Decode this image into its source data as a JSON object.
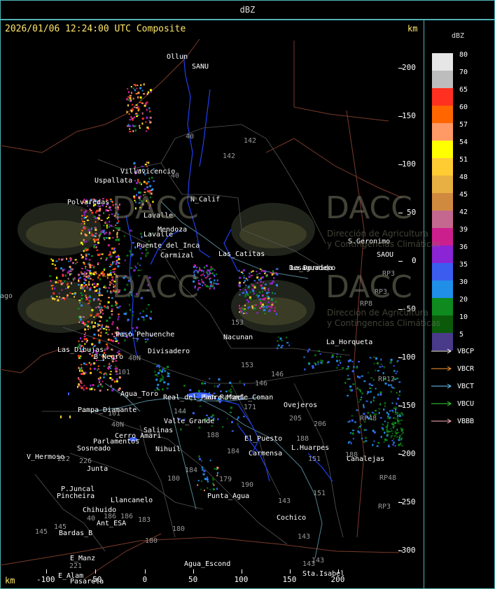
{
  "header": {
    "title": "dBZ"
  },
  "map": {
    "timestamp": "2026/01/06 12:24:00 UTC Composite",
    "km_top": "km",
    "km_bottom": "km",
    "y_ticks": [
      "200",
      "150",
      "100",
      "50",
      "0",
      "-50",
      "-100",
      "-150",
      "-200",
      "-250",
      "-300"
    ],
    "x_ticks": [
      "-100",
      "-50",
      "0",
      "50",
      "100",
      "150",
      "200"
    ],
    "watermark": {
      "brand": "DACC",
      "line1": "Dirección de Agricultura",
      "line2": "y Contingencias Climáticas"
    },
    "places": [
      {
        "name": "Ollun"
      },
      {
        "name": "SANU"
      },
      {
        "name": "Uspallata"
      },
      {
        "name": "Villavicencio"
      },
      {
        "name": "Polvaredas"
      },
      {
        "name": "N_Calif"
      },
      {
        "name": "Lavalle"
      },
      {
        "name": "Mendoza"
      },
      {
        "name": "Puente_del_Inca"
      },
      {
        "name": "Lavalle"
      },
      {
        "name": "Carmizal"
      },
      {
        "name": "Las_Catitas"
      },
      {
        "name": "S.Geronimo"
      },
      {
        "name": "Desaguadero"
      },
      {
        "name": "La_Dormida"
      },
      {
        "name": "SAOU"
      },
      {
        "name": "Paso_Pehuenche"
      },
      {
        "name": "Nacunan"
      },
      {
        "name": "La_Horqueta"
      },
      {
        "name": "Las_Dibujas"
      },
      {
        "name": "B_Negro"
      },
      {
        "name": "Divisadero"
      },
      {
        "name": "Agua_Toro"
      },
      {
        "name": "Pampa_Diamante"
      },
      {
        "name": "Real_del_Padre"
      },
      {
        "name": "San_Rafael"
      },
      {
        "name": "Monte_Coman"
      },
      {
        "name": "Ovejeros"
      },
      {
        "name": "Valle_Grande"
      },
      {
        "name": "Salinas"
      },
      {
        "name": "Cerro_Amari"
      },
      {
        "name": "Parlamentos"
      },
      {
        "name": "Sosneado"
      },
      {
        "name": "Nihuil"
      },
      {
        "name": "El_Puesto"
      },
      {
        "name": "Carmensa"
      },
      {
        "name": "L.Huarpes"
      },
      {
        "name": "Canalejas"
      },
      {
        "name": "V_Hermoso"
      },
      {
        "name": "Junta"
      },
      {
        "name": "P.Juncal"
      },
      {
        "name": "Pincheira"
      },
      {
        "name": "Llancanelo"
      },
      {
        "name": "Punta_Agua"
      },
      {
        "name": "Chihuido"
      },
      {
        "name": "Ant_ESA"
      },
      {
        "name": "Bardas_B"
      },
      {
        "name": "Cochico"
      },
      {
        "name": "E_Manz"
      },
      {
        "name": "E_Alam"
      },
      {
        "name": "Agua_Escond"
      },
      {
        "name": "Sta.Isabel"
      },
      {
        "name": "Pasarela"
      },
      {
        "name": "ago"
      }
    ],
    "route_numbers": [
      "142",
      "142",
      "40",
      "40",
      "153",
      "153",
      "146",
      "146",
      "143",
      "143",
      "143",
      "144",
      "171",
      "205",
      "206",
      "188",
      "184",
      "184",
      "180",
      "180",
      "179",
      "190",
      "151",
      "151",
      "188",
      "186",
      "186",
      "183",
      "180",
      "145",
      "221",
      "222",
      "226",
      "145",
      "40",
      "40N",
      "40N",
      "101",
      "101",
      "188",
      "RP3",
      "RP3",
      "RP12",
      "RP48",
      "RP48",
      "RP3",
      "RP8",
      "143"
    ]
  },
  "legend": {
    "title": "dBZ",
    "scale": [
      {
        "label": "80",
        "color": "#e6e6e6"
      },
      {
        "label": "70",
        "color": "#bdbdbd"
      },
      {
        "label": "65",
        "color": "#ff3020"
      },
      {
        "label": "60",
        "color": "#ff6600"
      },
      {
        "label": "57",
        "color": "#ff9966"
      },
      {
        "label": "54",
        "color": "#ffff00"
      },
      {
        "label": "51",
        "color": "#ffcc33"
      },
      {
        "label": "48",
        "color": "#e8b040"
      },
      {
        "label": "45",
        "color": "#d08a40"
      },
      {
        "label": "42",
        "color": "#c46890"
      },
      {
        "label": "39",
        "color": "#cc1f8e"
      },
      {
        "label": "36",
        "color": "#8a24d4"
      },
      {
        "label": "35",
        "color": "#3a5df0"
      },
      {
        "label": "30",
        "color": "#1f8fe8"
      },
      {
        "label": "20",
        "color": "#0e8a1e"
      },
      {
        "label": "10",
        "color": "#0a5a0a"
      },
      {
        "label": "5",
        "color": "#4a3a8a"
      }
    ],
    "radars": [
      {
        "name": "VBCP",
        "color": "#ffffff"
      },
      {
        "name": "VBCR",
        "color": "#ff9933"
      },
      {
        "name": "VBCT",
        "color": "#66ccff"
      },
      {
        "name": "VBCU",
        "color": "#33dd33"
      },
      {
        "name": "VBBB",
        "color": "#ffb6c1"
      }
    ]
  }
}
